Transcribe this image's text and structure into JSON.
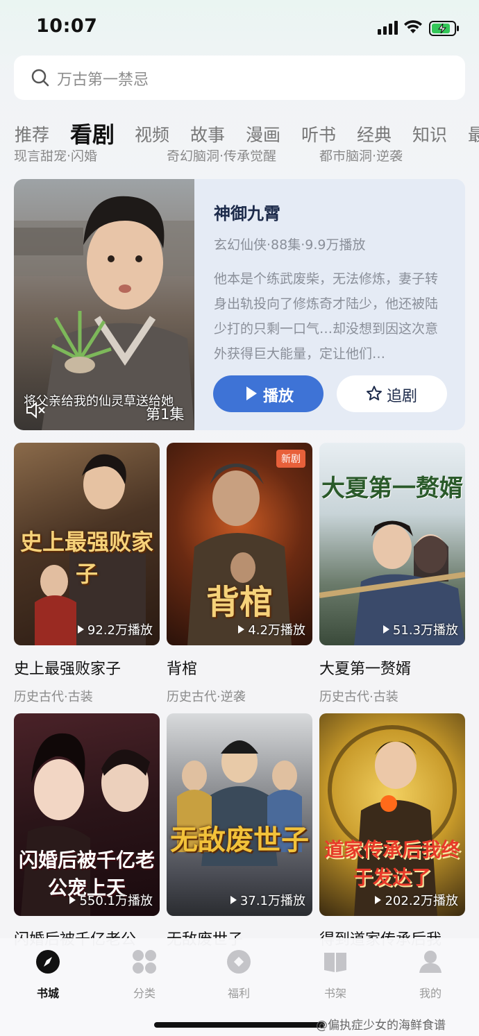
{
  "status_bar": {
    "time": "10:07"
  },
  "search": {
    "text": "万古第一禁忌"
  },
  "tabs": [
    "推荐",
    "看剧",
    "视频",
    "故事",
    "漫画",
    "听书",
    "经典",
    "知识",
    "最"
  ],
  "active_tab": "看剧",
  "sub_tags": [
    "现言甜宠·闪婚",
    "奇幻脑洞·传承觉醒",
    "都市脑洞·逆袭"
  ],
  "featured": {
    "title": "神御九霄",
    "meta": "玄幻仙侠·88集·9.9万播放",
    "description": "他本是个练武废柴，无法修炼，妻子转身出轨投向了修炼奇才陆少，他还被陆少打的只剩一口气…却没想到因这次意外获得巨大能量，定让他们…",
    "caption": "将父亲给我的仙灵草送给她",
    "episode": "第1集",
    "play_label": "播放",
    "follow_label": "追剧",
    "play_color": "#3e73d6"
  },
  "dramas": [
    {
      "title": "史上最强败家子",
      "tags": "历史古代·古装",
      "plays": "92.2万播放",
      "poster_text": "史上最强败家子",
      "badge": ""
    },
    {
      "title": "背棺",
      "tags": "历史古代·逆袭",
      "plays": "4.2万播放",
      "poster_text": "背棺",
      "badge": "新剧"
    },
    {
      "title": "大夏第一赘婿",
      "tags": "历史古代·古装",
      "plays": "51.3万播放",
      "poster_text": "大夏第一赘婿",
      "badge": ""
    },
    {
      "title": "闪婚后被千亿老公",
      "tags": "",
      "plays": "550.1万播放",
      "poster_text": "闪婚后被千亿老公宠上天",
      "badge": ""
    },
    {
      "title": "无敌废世子",
      "tags": "",
      "plays": "37.1万播放",
      "poster_text": "无敌废世子",
      "badge": ""
    },
    {
      "title": "得到道家传承后我",
      "tags": "",
      "plays": "202.2万播放",
      "poster_text": "道家传承后我终于发达了",
      "badge": ""
    }
  ],
  "bottom_nav": [
    {
      "label": "书城",
      "icon": "compass-icon",
      "active": true
    },
    {
      "label": "分类",
      "icon": "grid-icon",
      "active": false
    },
    {
      "label": "福利",
      "icon": "coin-icon",
      "active": false
    },
    {
      "label": "书架",
      "icon": "book-icon",
      "active": false
    },
    {
      "label": "我的",
      "icon": "person-icon",
      "active": false
    }
  ],
  "watermark": "@偏执症少女的海鲜食谱"
}
